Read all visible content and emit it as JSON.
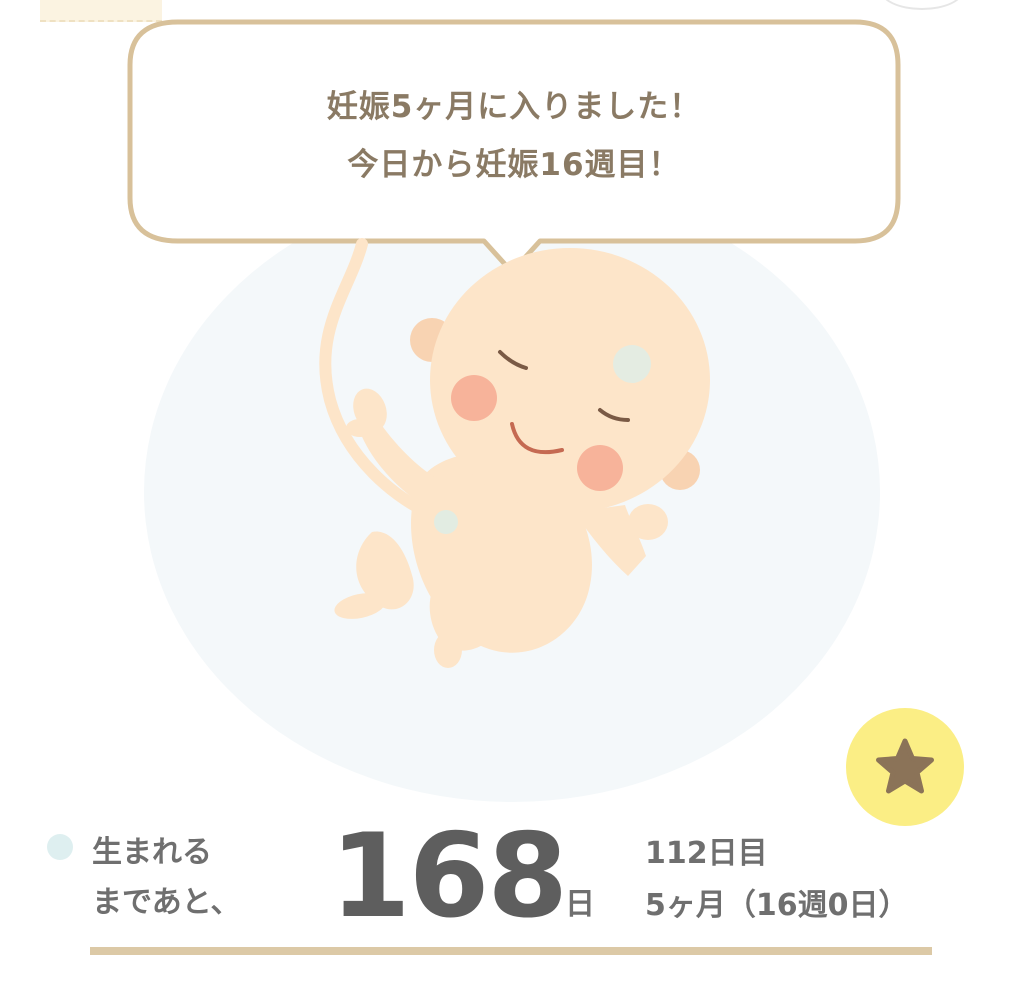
{
  "speech_bubble": {
    "line1": "妊娠5ヶ月に入りました！",
    "line2": "今日から妊娠16週目！"
  },
  "illustration": {
    "subject_icon": "baby-fetus-illustration",
    "womb_icon": "womb-circle"
  },
  "favorite": {
    "icon": "star-icon"
  },
  "countdown": {
    "label_line1": "生まれる",
    "label_line2": "まであと、",
    "days_left": "168",
    "unit": "日"
  },
  "pregnancy_info": {
    "day_count": "112日目",
    "month_week": "5ヶ月（16週0日）"
  },
  "colors": {
    "bubble_border": "#d8c19a",
    "bubble_text": "#8a7a64",
    "womb_fill": "#f4f8fa",
    "skin": "#fde5c9",
    "cheek": "#f7b39a",
    "favorite_bg": "#fbee85",
    "star": "#8b7358",
    "rule": "#dcc9a6",
    "text": "#6f6f6f"
  }
}
